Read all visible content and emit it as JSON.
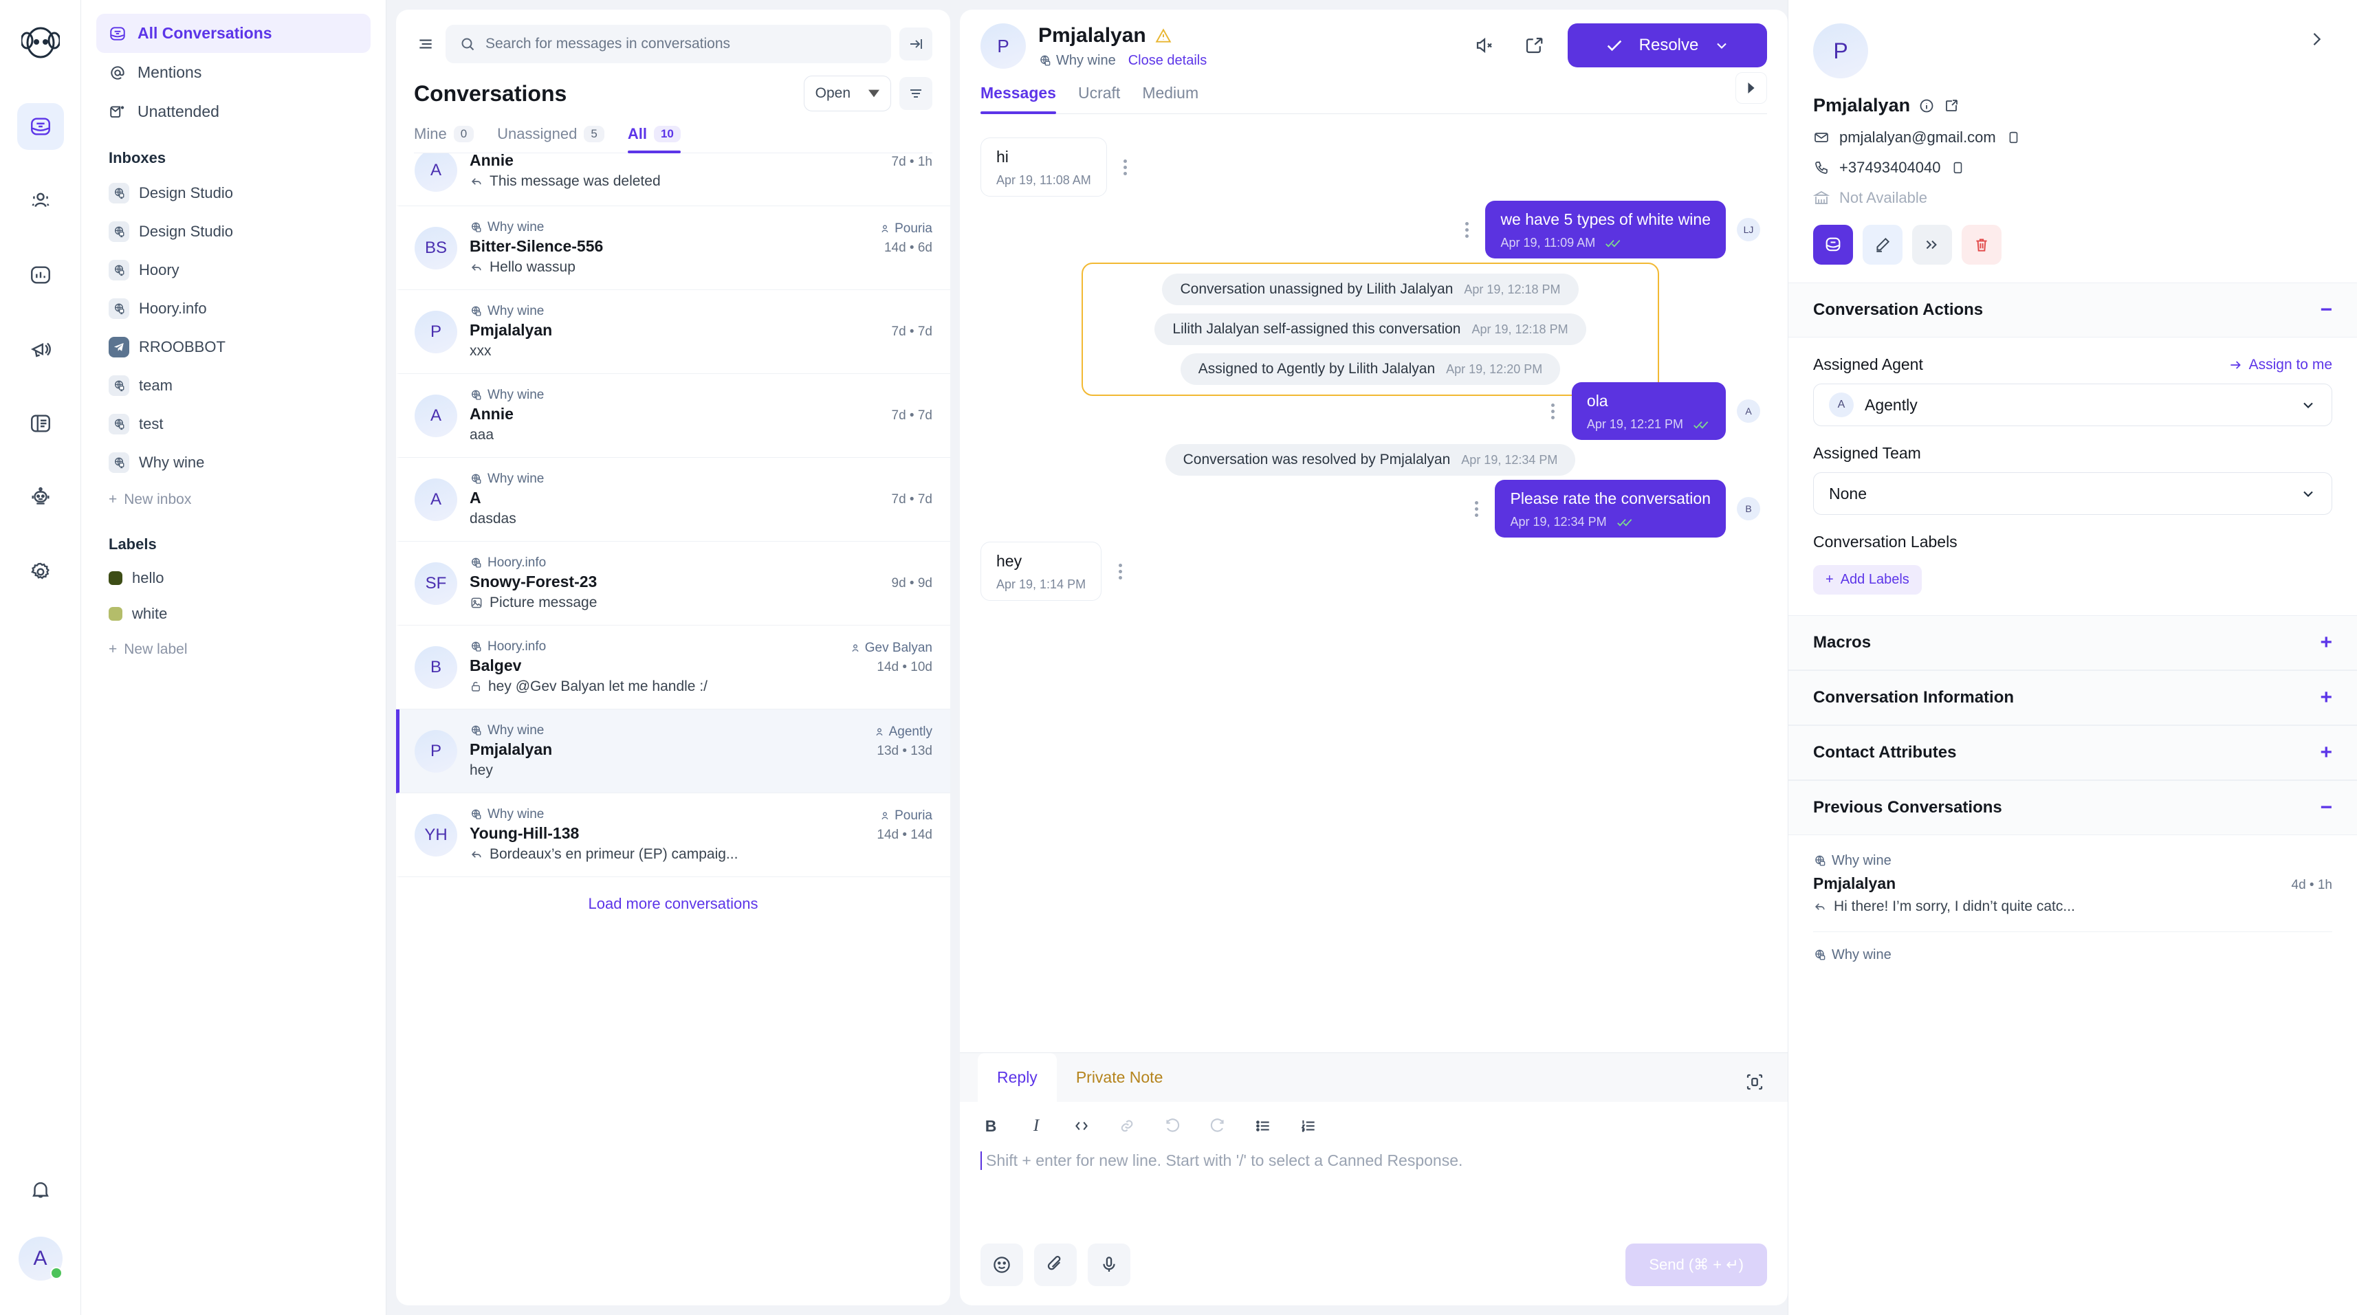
{
  "rail": {
    "icons": [
      {
        "name": "conversations-icon",
        "active": true
      },
      {
        "name": "contacts-icon",
        "active": false
      },
      {
        "name": "reports-icon",
        "active": false
      },
      {
        "name": "campaigns-icon",
        "active": false
      },
      {
        "name": "help-center-icon",
        "active": false
      },
      {
        "name": "bot-icon",
        "active": false
      },
      {
        "name": "settings-icon",
        "active": false
      }
    ],
    "notification_icon": "bell-icon",
    "avatar_initial": "A"
  },
  "sidebar": {
    "nav": [
      {
        "label": "All Conversations",
        "icon": "inbox-icon",
        "active": true
      },
      {
        "label": "Mentions",
        "icon": "at-icon",
        "active": false
      },
      {
        "label": "Unattended",
        "icon": "unattended-envelope-icon",
        "active": false
      }
    ],
    "inboxes_title": "Inboxes",
    "inboxes": [
      {
        "label": "Design Studio",
        "icon": "website-icon"
      },
      {
        "label": "Design Studio",
        "icon": "website-icon"
      },
      {
        "label": "Hoory",
        "icon": "website-icon"
      },
      {
        "label": "Hoory.info",
        "icon": "website-icon"
      },
      {
        "label": "RROOBBOT",
        "icon": "telegram-icon"
      },
      {
        "label": "team",
        "icon": "website-icon"
      },
      {
        "label": "test",
        "icon": "website-icon"
      },
      {
        "label": "Why wine",
        "icon": "website-icon"
      }
    ],
    "new_inbox": "New inbox",
    "labels_title": "Labels",
    "labels": [
      {
        "label": "hello",
        "color": "#3d4d16"
      },
      {
        "label": "white",
        "color": "#b4bd6a"
      }
    ],
    "new_label": "New label"
  },
  "conversations": {
    "search_placeholder": "Search for messages in conversations",
    "title": "Conversations",
    "status_filter": "Open",
    "tabs": [
      {
        "label": "Mine",
        "count": "0",
        "active": false
      },
      {
        "label": "Unassigned",
        "count": "5",
        "active": false
      },
      {
        "label": "All",
        "count": "10",
        "active": true
      }
    ],
    "items": [
      {
        "initials": "A",
        "inbox": "",
        "name": "Annie",
        "preview": "This message was deleted",
        "preview_icon": "reply-arrow-icon",
        "time": "7d • 1h",
        "assignee": "",
        "selected": false
      },
      {
        "initials": "BS",
        "inbox": "Why wine",
        "name": "Bitter-Silence-556",
        "preview": "Hello wassup",
        "preview_icon": "reply-arrow-icon",
        "time": "14d • 6d",
        "assignee": "Pouria",
        "selected": false
      },
      {
        "initials": "P",
        "inbox": "Why wine",
        "name": "Pmjalalyan",
        "preview": "xxx",
        "preview_icon": "",
        "time": "7d • 7d",
        "assignee": "",
        "selected": false
      },
      {
        "initials": "A",
        "inbox": "Why wine",
        "name": "Annie",
        "preview": "aaa",
        "preview_icon": "",
        "time": "7d • 7d",
        "assignee": "",
        "selected": false
      },
      {
        "initials": "A",
        "inbox": "Why wine",
        "name": "A",
        "preview": "dasdas",
        "preview_icon": "",
        "time": "7d • 7d",
        "assignee": "",
        "selected": false
      },
      {
        "initials": "SF",
        "inbox": "Hoory.info",
        "name": "Snowy-Forest-23",
        "preview": "Picture message",
        "preview_icon": "image-icon",
        "time": "9d • 9d",
        "assignee": "",
        "selected": false
      },
      {
        "initials": "B",
        "inbox": "Hoory.info",
        "name": "Balgev",
        "preview": "hey @Gev Balyan let me handle :/",
        "preview_icon": "lock-icon",
        "time": "14d • 10d",
        "assignee": "Gev Balyan",
        "selected": false
      },
      {
        "initials": "P",
        "inbox": "Why wine",
        "name": "Pmjalalyan",
        "preview": "hey",
        "preview_icon": "",
        "time": "13d • 13d",
        "assignee": "Agently",
        "selected": true
      },
      {
        "initials": "YH",
        "inbox": "Why wine",
        "name": "Young-Hill-138",
        "preview": "Bordeaux’s en primeur (EP) campaig...",
        "preview_icon": "reply-arrow-icon",
        "time": "14d • 14d",
        "assignee": "Pouria",
        "selected": false
      }
    ],
    "load_more": "Load more conversations"
  },
  "chat": {
    "avatar_initial": "P",
    "name": "Pmjalalyan",
    "warning_icon": "warning-triangle-icon",
    "inbox": "Why wine",
    "close_details": "Close details",
    "mute_icon": "mute-icon",
    "share_icon": "share-icon",
    "resolve_label": "Resolve",
    "tabs": [
      {
        "label": "Messages",
        "active": true
      },
      {
        "label": "Ucraft",
        "active": false
      },
      {
        "label": "Medium",
        "active": false
      }
    ],
    "messages": [
      {
        "kind": "incoming",
        "text": "hi",
        "time": "Apr 19, 11:08 AM"
      },
      {
        "kind": "outgoing",
        "text": "we have 5 types of white wine",
        "time": "Apr 19, 11:09 AM",
        "sender_initials": "LJ"
      },
      {
        "kind": "activity_group",
        "items": [
          {
            "text": "Conversation unassigned by Lilith Jalalyan",
            "time": "Apr 19, 12:18 PM"
          },
          {
            "text": "Lilith Jalalyan self-assigned this conversation",
            "time": "Apr 19, 12:18 PM"
          },
          {
            "text": "Assigned to Agently by Lilith Jalalyan",
            "time": "Apr 19, 12:20 PM"
          }
        ]
      },
      {
        "kind": "outgoing",
        "text": "ola",
        "time": "Apr 19, 12:21 PM",
        "sender_initials": "A"
      },
      {
        "kind": "activity",
        "text": "Conversation was resolved by Pmjalalyan",
        "time": "Apr 19, 12:34 PM"
      },
      {
        "kind": "outgoing",
        "text": "Please rate the conversation",
        "time": "Apr 19, 12:34 PM",
        "sender_initials": "B"
      },
      {
        "kind": "incoming",
        "text": "hey",
        "time": "Apr 19, 1:14 PM"
      }
    ]
  },
  "reply": {
    "tabs": [
      {
        "label": "Reply",
        "active": true
      },
      {
        "label": "Private Note",
        "active": false
      }
    ],
    "expand_icon": "expand-icon",
    "format_buttons": [
      "bold-icon",
      "italic-icon",
      "code-icon",
      "link-icon",
      "undo-icon",
      "redo-icon",
      "bullet-list-icon",
      "numbered-list-icon"
    ],
    "placeholder": "Shift + enter for new line. Start with '/' to select a Canned Response.",
    "emoji_icon": "emoji-icon",
    "attach_icon": "paperclip-icon",
    "mic_icon": "microphone-icon",
    "send_label": "Send (⌘ + ↵)"
  },
  "contact_panel": {
    "avatar_initial": "P",
    "name": "Pmjalalyan",
    "info_icon": "info-icon",
    "external_icon": "external-link-icon",
    "email": "pmjalalyan@gmail.com",
    "phone": "+37493404040",
    "company": "Not Available",
    "actions": [
      {
        "name": "conversation-icon",
        "style": "primary"
      },
      {
        "name": "edit-icon",
        "style": "light"
      },
      {
        "name": "merge-icon",
        "style": "grey"
      },
      {
        "name": "delete-icon",
        "style": "danger"
      }
    ],
    "sections": [
      {
        "title": "Conversation Actions",
        "expanded": true
      },
      {
        "title": "Macros",
        "expanded": false
      },
      {
        "title": "Conversation Information",
        "expanded": false
      },
      {
        "title": "Contact Attributes",
        "expanded": false
      },
      {
        "title": "Previous Conversations",
        "expanded": true
      }
    ],
    "assigned_agent_label": "Assigned Agent",
    "assign_to_me": "Assign to me",
    "assigned_agent_value": "Agently",
    "assigned_agent_initial": "A",
    "assigned_team_label": "Assigned Team",
    "assigned_team_value": "None",
    "conversation_labels_label": "Conversation Labels",
    "add_labels": "Add Labels",
    "previous_conversations": [
      {
        "inbox": "Why wine",
        "name": "Pmjalalyan",
        "time": "4d • 1h",
        "preview": "Hi there! I’m sorry, I didn’t quite catc...",
        "preview_icon": "reply-arrow-icon"
      },
      {
        "inbox": "Why wine",
        "name": "",
        "time": "",
        "preview": "",
        "preview_icon": ""
      }
    ]
  },
  "colors": {
    "accent": "#5b33e0",
    "accent_light": "#f1f0fe",
    "warning": "#f2b933",
    "danger": "#e24a4a",
    "online": "#4ec35a"
  }
}
